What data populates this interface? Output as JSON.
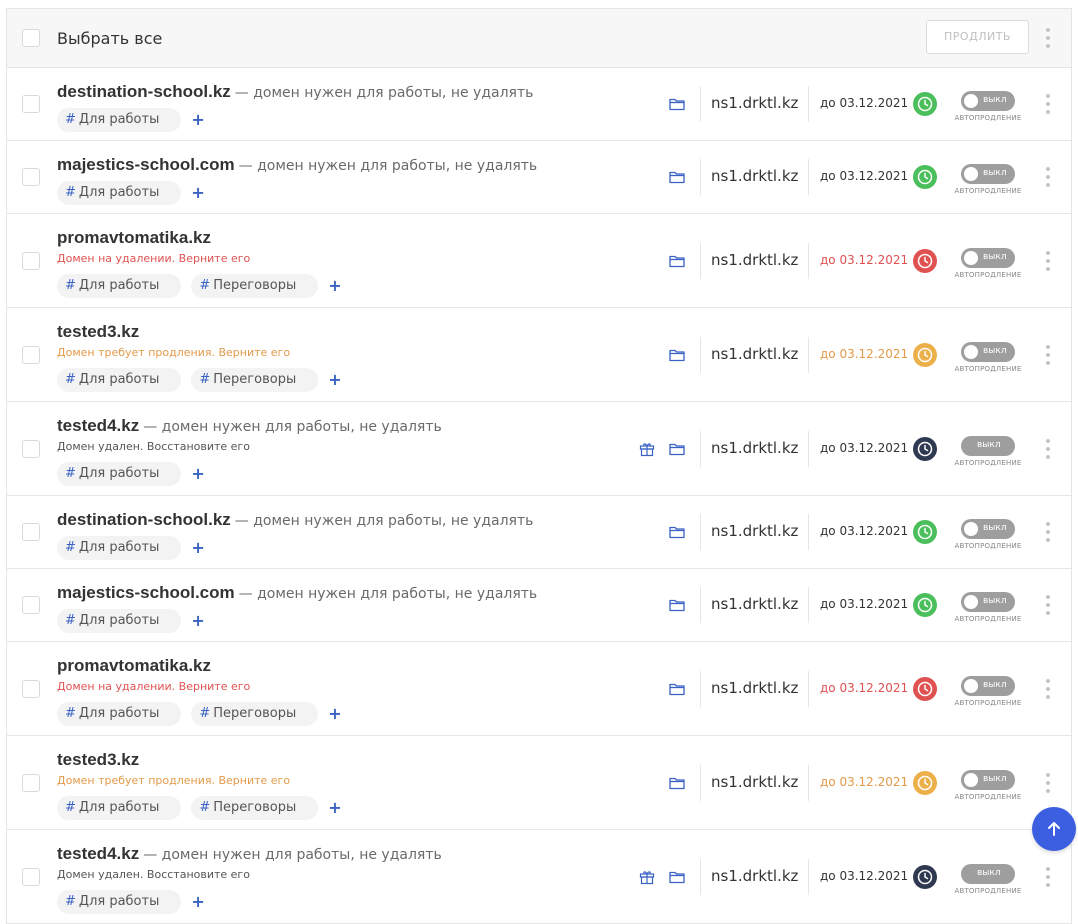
{
  "header": {
    "select_all_label": "Выбрать все",
    "renew_button": "ПРОДЛИТЬ"
  },
  "colors": {
    "accent": "#3a62c4",
    "ok": "#4bbf5b",
    "danger": "#e05252",
    "warning": "#ecb04a",
    "removed": "#2f3a52"
  },
  "rows": [
    {
      "domain": "destination-school.kz",
      "note": "— домен нужен для работы, не удалять",
      "status_text": "",
      "tags": [
        "Для работы"
      ],
      "ns": "ns1.drktl.kz",
      "date": "до 03.12.2021",
      "status": "ok",
      "toggle": "выкл",
      "toggle_caption": "АВТОПРОДЛЕНИЕ",
      "gift": false
    },
    {
      "domain": "majestics-school.com",
      "note": "— домен нужен для работы, не удалять",
      "status_text": "",
      "tags": [
        "Для работы"
      ],
      "ns": "ns1.drktl.kz",
      "date": "до 03.12.2021",
      "status": "ok",
      "toggle": "выкл",
      "toggle_caption": "АВТОПРОДЛЕНИЕ",
      "gift": false
    },
    {
      "domain": "promavtomatika.kz",
      "note": "",
      "status_text": "Домен на удалении. Верните его",
      "tags": [
        "Для работы",
        "Переговоры"
      ],
      "ns": "ns1.drktl.kz",
      "date": "до 03.12.2021",
      "status": "danger",
      "toggle": "выкл",
      "toggle_caption": "АВТОПРОДЛЕНИЕ",
      "gift": false
    },
    {
      "domain": "tested3.kz",
      "note": "",
      "status_text": "Домен требует продления. Верните его",
      "tags": [
        "Для работы",
        "Переговоры"
      ],
      "ns": "ns1.drktl.kz",
      "date": "до 03.12.2021",
      "status": "warning",
      "toggle": "выкл",
      "toggle_caption": "АВТОПРОДЛЕНИЕ",
      "gift": false
    },
    {
      "domain": "tested4.kz",
      "note": "— домен нужен для работы, не удалять",
      "status_text": "Домен удален. Восстановите его",
      "tags": [
        "Для работы"
      ],
      "ns": "ns1.drktl.kz",
      "date": "до 03.12.2021",
      "status": "removed",
      "toggle": "выкл",
      "toggle_caption": "АВТОПРОДЛЕНИЕ",
      "gift": true
    },
    {
      "domain": "destination-school.kz",
      "note": "— домен нужен для работы, не удалять",
      "status_text": "",
      "tags": [
        "Для работы"
      ],
      "ns": "ns1.drktl.kz",
      "date": "до 03.12.2021",
      "status": "ok",
      "toggle": "выкл",
      "toggle_caption": "АВТОПРОДЛЕНИЕ",
      "gift": false
    },
    {
      "domain": "majestics-school.com",
      "note": "— домен нужен для работы, не удалять",
      "status_text": "",
      "tags": [
        "Для работы"
      ],
      "ns": "ns1.drktl.kz",
      "date": "до 03.12.2021",
      "status": "ok",
      "toggle": "выкл",
      "toggle_caption": "АВТОПРОДЛЕНИЕ",
      "gift": false
    },
    {
      "domain": "promavtomatika.kz",
      "note": "",
      "status_text": "Домен на удалении. Верните его",
      "tags": [
        "Для работы",
        "Переговоры"
      ],
      "ns": "ns1.drktl.kz",
      "date": "до 03.12.2021",
      "status": "danger",
      "toggle": "выкл",
      "toggle_caption": "АВТОПРОДЛЕНИЕ",
      "gift": false
    },
    {
      "domain": "tested3.kz",
      "note": "",
      "status_text": "Домен требует продления. Верните его",
      "tags": [
        "Для работы",
        "Переговоры"
      ],
      "ns": "ns1.drktl.kz",
      "date": "до 03.12.2021",
      "status": "warning",
      "toggle": "выкл",
      "toggle_caption": "АВТОПРОДЛЕНИЕ",
      "gift": false
    },
    {
      "domain": "tested4.kz",
      "note": "— домен нужен для работы, не удалять",
      "status_text": "Домен удален. Восстановите его",
      "tags": [
        "Для работы"
      ],
      "ns": "ns1.drktl.kz",
      "date": "до 03.12.2021",
      "status": "removed",
      "toggle": "выкл",
      "toggle_caption": "АВТОПРОДЛЕНИЕ",
      "gift": true
    }
  ],
  "icons": {
    "select_all": "checkbox-icon",
    "menu": "kebab-menu-icon",
    "folder": "folder-icon",
    "gift": "gift-icon",
    "clock": "clock-icon",
    "scroll_top": "arrow-up-icon"
  }
}
